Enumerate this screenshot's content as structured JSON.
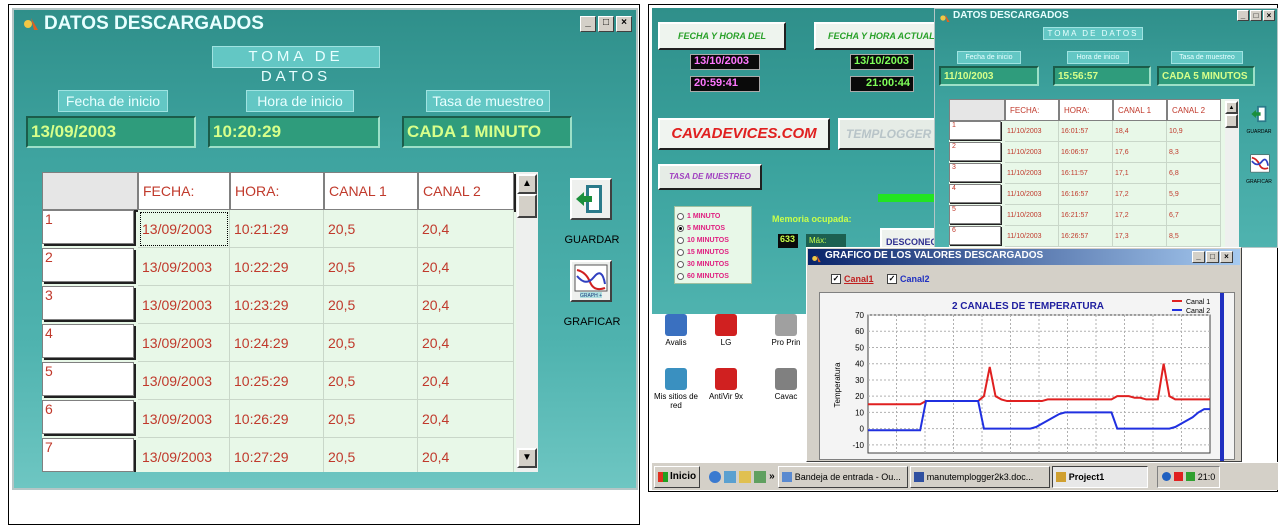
{
  "left_window": {
    "title": "DATOS DESCARGADOS",
    "header": "TOMA DE DATOS",
    "labels": {
      "start_date": "Fecha de inicio",
      "start_time": "Hora de inicio",
      "rate": "Tasa de muestreo"
    },
    "values": {
      "start_date": "13/09/2003",
      "start_time": "10:20:29",
      "rate": "CADA 1 MINUTO"
    },
    "columns": [
      "",
      "FECHA:",
      "HORA:",
      "CANAL 1",
      "CANAL 2"
    ],
    "rows": [
      [
        "1",
        "13/09/2003",
        "10:21:29",
        "20,5",
        "20,4"
      ],
      [
        "2",
        "13/09/2003",
        "10:22:29",
        "20,5",
        "20,4"
      ],
      [
        "3",
        "13/09/2003",
        "10:23:29",
        "20,5",
        "20,4"
      ],
      [
        "4",
        "13/09/2003",
        "10:24:29",
        "20,5",
        "20,4"
      ],
      [
        "5",
        "13/09/2003",
        "10:25:29",
        "20,5",
        "20,4"
      ],
      [
        "6",
        "13/09/2003",
        "10:26:29",
        "20,5",
        "20,4"
      ],
      [
        "7",
        "13/09/2003",
        "10:27:29",
        "20,5",
        "20,4"
      ]
    ],
    "save_label": "GUARDAR",
    "graph_label": "GRAFICAR",
    "graph_icon_text": "GRAPH +"
  },
  "logger_panel": {
    "btn_logger_time": "FECHA Y HORA DEL LOGGER",
    "btn_current_time": "FECHA Y HORA ACTUAL",
    "logger_date": "13/10/2003",
    "logger_time": "20:59:41",
    "current_date": "13/10/2003",
    "current_time": "21:00:44",
    "brand": "CAVADEVICES.COM",
    "brand2": "TEMPLOGGER",
    "rate_btn": "TASA DE MUESTREO",
    "rate_options": [
      "1 MINUTO",
      "5 MINUTOS",
      "10 MINUTOS",
      "15 MINUTOS",
      "30 MINUTOS",
      "60 MINUTOS"
    ],
    "rate_selected": "5 MINUTOS",
    "memory_label": "Memoria ocupada:",
    "memory_value": "633",
    "memory_max": "Máx: 2000",
    "disconnect": "DESCONEC"
  },
  "right_window": {
    "title": "DATOS DESCARGADOS",
    "header": "TOMA DE DATOS",
    "labels": {
      "start_date": "Fecha de inicio",
      "start_time": "Hora de inicio",
      "rate": "Tasa de muestreo"
    },
    "values": {
      "start_date": "11/10/2003",
      "start_time": "15:56:57",
      "rate": "CADA 5 MINUTOS"
    },
    "columns": [
      "",
      "FECHA:",
      "HORA:",
      "CANAL 1",
      "CANAL 2"
    ],
    "rows": [
      [
        "1",
        "11/10/2003",
        "16:01:57",
        "18,4",
        "10,9"
      ],
      [
        "2",
        "11/10/2003",
        "16:06:57",
        "17,6",
        "8,3"
      ],
      [
        "3",
        "11/10/2003",
        "16:11:57",
        "17,1",
        "6,8"
      ],
      [
        "4",
        "11/10/2003",
        "16:16:57",
        "17,2",
        "5,9"
      ],
      [
        "5",
        "11/10/2003",
        "16:21:57",
        "17,2",
        "6,7"
      ],
      [
        "6",
        "11/10/2003",
        "16:26:57",
        "17,3",
        "8,5"
      ]
    ],
    "save_label": "GUARDAR",
    "graph_label": "GRAFICAR"
  },
  "graph_window": {
    "title": "GRAFICO DE LOS VALORES DESCARGADOS",
    "check1": "Canal1",
    "check2": "Canal2",
    "colors": {
      "canal1": "#e02020",
      "canal2": "#2030e0"
    }
  },
  "chart_data": {
    "type": "line",
    "title": "2 CANALES DE TEMPERATURA",
    "ylabel": "Temperatura",
    "xlabel": "",
    "ylim": [
      -15,
      70
    ],
    "yticks": [
      70,
      60,
      50,
      40,
      30,
      20,
      10,
      0,
      -10
    ],
    "grid": true,
    "legend_placement": "top-right",
    "series": [
      {
        "name": "Canal 1",
        "values": [
          15,
          15,
          15,
          15,
          15,
          15,
          15,
          15,
          15,
          15,
          17,
          17,
          17,
          17,
          17,
          17,
          17,
          17,
          17,
          17,
          20,
          38,
          20,
          18,
          17,
          17,
          17,
          17,
          17,
          17,
          17,
          18,
          18,
          18,
          18,
          18,
          18,
          18,
          18,
          18,
          18,
          18,
          18,
          20,
          20,
          20,
          19,
          19,
          18,
          18,
          18,
          40,
          20,
          18,
          18,
          18,
          18,
          18,
          18,
          18
        ]
      },
      {
        "name": "Canal 2",
        "values": [
          -1,
          -1,
          -1,
          -1,
          -1,
          -1,
          -1,
          -1,
          -1,
          -1,
          17,
          17,
          17,
          17,
          17,
          17,
          17,
          17,
          17,
          17,
          0,
          0,
          0,
          0,
          0,
          0,
          0,
          0,
          0,
          1,
          3,
          5,
          7,
          9,
          10,
          10,
          10,
          10,
          10,
          10,
          10,
          10,
          10,
          0,
          0,
          0,
          0,
          0,
          0,
          0,
          0,
          0,
          0,
          1,
          3,
          5,
          7,
          10,
          12,
          12
        ]
      }
    ]
  },
  "desktop": {
    "icons": [
      "Avalis",
      "LG",
      "Pro Prin",
      "Mis sitios de red",
      "AntiVir 9x",
      "Cavac"
    ]
  },
  "taskbar": {
    "start": "Inicio",
    "quick": "»",
    "items": [
      "Bandeja de entrada - Ou...",
      "manutemplogger2k3.doc...",
      "Project1"
    ],
    "clock": "21:0"
  }
}
